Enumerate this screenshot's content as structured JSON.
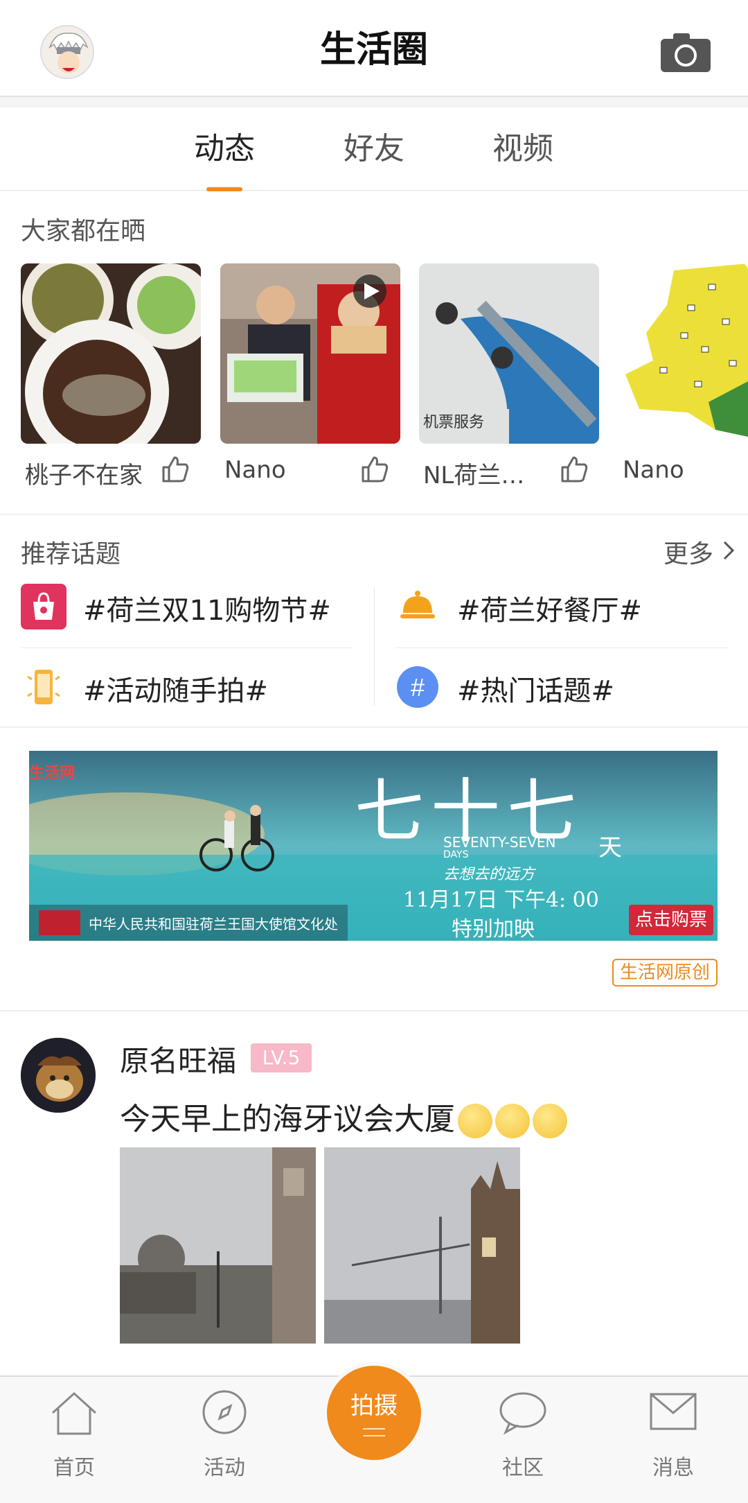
{
  "header": {
    "title": "生活圈",
    "camera_icon": "camera-icon",
    "avatar": "user-avatar"
  },
  "tabs": [
    {
      "label": "动态",
      "active": true
    },
    {
      "label": "好友",
      "active": false
    },
    {
      "label": "视频",
      "active": false
    }
  ],
  "sharing": {
    "title": "大家都在晒",
    "items": [
      {
        "name": "桃子不在家"
      },
      {
        "name": "Nano",
        "caption": ""
      },
      {
        "name": "NL荷兰…",
        "caption": "机票服务"
      },
      {
        "name": "Nano"
      }
    ]
  },
  "topics": {
    "title": "推荐话题",
    "more_label": "更多",
    "items": [
      {
        "label": "#荷兰双11购物节#",
        "icon": "shopping-bag-icon"
      },
      {
        "label": "#荷兰好餐厅#",
        "icon": "dining-bell-icon"
      },
      {
        "label": "#活动随手拍#",
        "icon": "phone-icon"
      },
      {
        "label": "#热门话题#",
        "icon": "hashtag-icon"
      }
    ]
  },
  "banner": {
    "brand": "生活网",
    "title_big": "七十七",
    "title_tian": "天",
    "subtitle_en": "SEVENTY-SEVEN",
    "subtitle_days": "DAYS",
    "tagline": "去想去的远方",
    "date": "11月17日 下午4: 00",
    "special": "特别加映",
    "sponsor": "中华人民共和国驻荷兰王国大使馆文化处",
    "cta": "点击购票",
    "badge": "生活网原创"
  },
  "post": {
    "user": "原名旺福",
    "level": "LV.5",
    "text": "今天早上的海牙议会大厦"
  },
  "tabbar": {
    "items": [
      {
        "label": "首页",
        "icon": "home-icon"
      },
      {
        "label": "活动",
        "icon": "compass-icon"
      },
      {
        "label": "社区",
        "icon": "chat-bubble-icon"
      },
      {
        "label": "消息",
        "icon": "envelope-icon"
      }
    ],
    "center": {
      "label": "拍摄"
    }
  },
  "colors": {
    "accent": "#f08a1c",
    "level_badge": "#f7b8c7"
  }
}
